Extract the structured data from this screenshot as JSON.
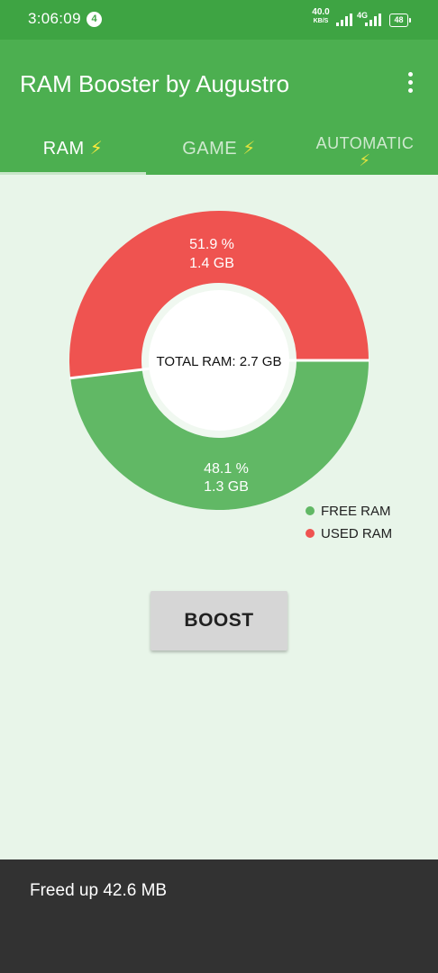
{
  "status_bar": {
    "time": "3:06:09",
    "notification_count": "4",
    "net_speed_value": "40.0",
    "net_speed_unit": "KB/S",
    "network_type": "4G",
    "battery": "48"
  },
  "app_bar": {
    "title": "RAM Booster by Augustro",
    "menu_icon": "more-vert-icon"
  },
  "tabs": [
    {
      "label": "RAM",
      "icon": "lightning-icon",
      "selected": true
    },
    {
      "label": "GAME",
      "icon": "lightning-icon",
      "selected": false
    },
    {
      "label": "AUTOMATIC",
      "icon": "lightning-icon",
      "selected": false
    }
  ],
  "colors": {
    "status_bar": "#3ea443",
    "app_bar": "#4caf50",
    "background": "#e8f5e9",
    "free_ram": "#61b865",
    "used_ram": "#ef5350",
    "snackbar": "#323232"
  },
  "chart_data": {
    "type": "pie",
    "center_label": "TOTAL RAM: 2.7 GB",
    "slices": [
      {
        "name": "FREE RAM",
        "percent": 48.1,
        "percent_label": "48.1 %",
        "size_label": "1.3 GB",
        "color": "#61b865"
      },
      {
        "name": "USED RAM",
        "percent": 51.9,
        "percent_label": "51.9 %",
        "size_label": "1.4 GB",
        "color": "#ef5350"
      }
    ],
    "legend": {
      "placement": "bottom-right",
      "items": [
        "FREE RAM",
        "USED RAM"
      ]
    }
  },
  "boost_button": {
    "label": "BOOST"
  },
  "snackbar": {
    "message": "Freed up 42.6 MB"
  }
}
